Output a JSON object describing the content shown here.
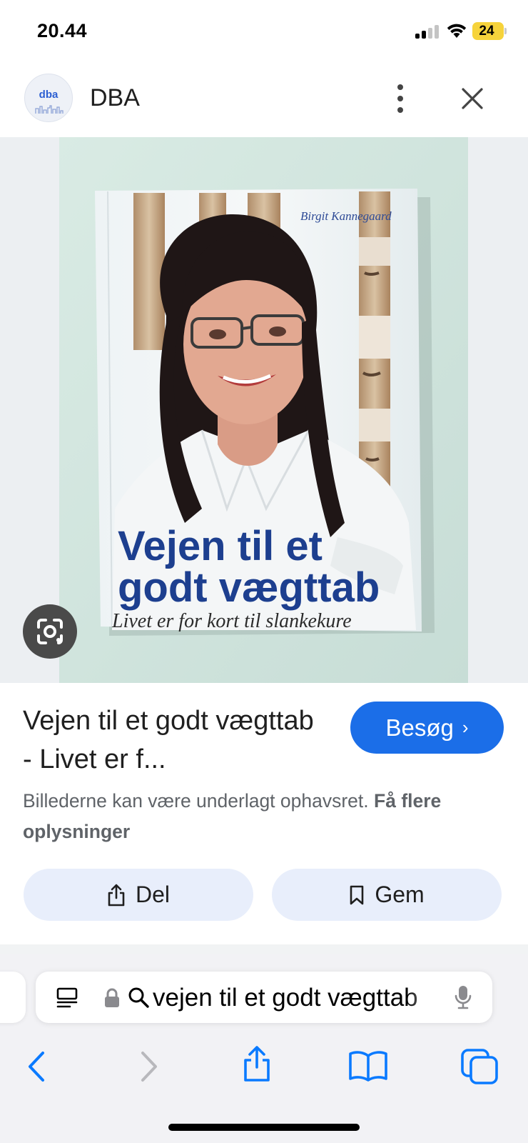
{
  "status_bar": {
    "time": "20.44",
    "battery": "24"
  },
  "header": {
    "logo_text": "dba",
    "site_name": "DBA"
  },
  "book_cover": {
    "author": "Birgit Kannegaard",
    "title_line1": "Vejen til et",
    "title_line2": "godt vægttab",
    "subtitle": "Livet er for kort til slankekure"
  },
  "result": {
    "title": "Vejen til et godt vægttab - Livet er f...",
    "visit_label": "Besøg",
    "visit_chevron": "›",
    "copyright_text": "Billederne kan være underlagt ophavsret.",
    "more_info_label": "Få flere oplysninger",
    "share_label": "Del",
    "save_label": "Gem"
  },
  "browser": {
    "url_text": "vejen til et godt vægttab"
  },
  "colors": {
    "accent_blue": "#1b6ee8",
    "pill_background": "#e8eefb",
    "battery_yellow": "#f6d33b",
    "ios_blue": "#0a7aff",
    "cover_title_blue": "#1d3f8f"
  },
  "icons": {
    "status": [
      "signal-icon",
      "wifi-icon",
      "battery-icon"
    ],
    "header": [
      "more-vert-icon",
      "close-icon"
    ],
    "image": [
      "google-lens-icon"
    ],
    "actions": [
      "share-icon",
      "bookmark-icon"
    ],
    "address_bar": [
      "reader-mode-icon",
      "lock-icon",
      "search-icon",
      "microphone-icon"
    ],
    "toolbar": [
      "back-arrow-icon",
      "forward-arrow-icon",
      "share-icon",
      "bookmarks-book-icon",
      "tabs-icon"
    ]
  }
}
